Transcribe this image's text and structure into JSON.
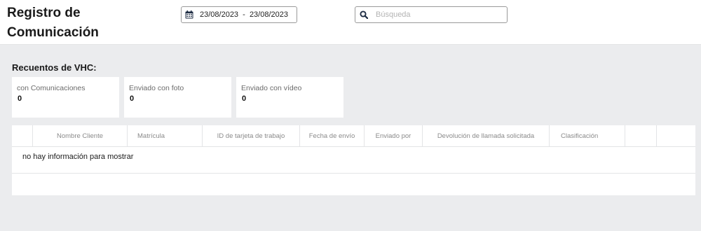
{
  "header": {
    "title": "Registro de Comunicación",
    "date_range": "23/08/2023  -  23/08/2023",
    "search_placeholder": "Búsqueda"
  },
  "counts": {
    "title": "Recuentos de VHC:",
    "cards": [
      {
        "label": "con Comunicaciones",
        "value": "0"
      },
      {
        "label": "Enviado con foto",
        "value": "0"
      },
      {
        "label": "Enviado con vídeo",
        "value": "0"
      }
    ]
  },
  "table": {
    "columns": [
      "",
      "Nombre Cliente",
      "Matrícula",
      "ID de tarjeta de trabajo",
      "Fecha de envío",
      "Enviado por",
      "Devolución de llamada solicitada",
      "Clasificación",
      "",
      ""
    ],
    "empty_message": "no hay información para mostrar"
  },
  "icons": {
    "date": "calendar-icon",
    "search": "search-icon"
  },
  "colors": {
    "page_bg": "#ebecee",
    "icon": "#1f2d44"
  }
}
